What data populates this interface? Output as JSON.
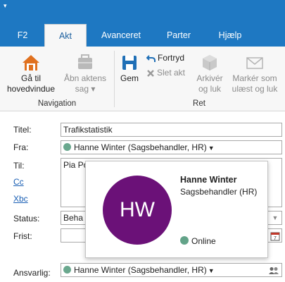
{
  "quick_access": {
    "icon": "caret-down-icon",
    "glyph": "▾"
  },
  "tabs": [
    {
      "label": "F2",
      "active": false
    },
    {
      "label": "Akt",
      "active": true
    },
    {
      "label": "Avanceret",
      "active": false
    },
    {
      "label": "Parter",
      "active": false
    },
    {
      "label": "Hjælp",
      "active": false
    }
  ],
  "ribbon": {
    "navigation": {
      "group_label": "Navigation",
      "home": {
        "line1": "Gå til",
        "line2": "hovedvindue"
      },
      "open_case": {
        "line1": "Åbn aktens",
        "line2": "sag ▾"
      }
    },
    "ret": {
      "group_label": "Ret",
      "save": "Gem",
      "undo": "Fortryd",
      "delete": "Slet akt",
      "archive": {
        "line1": "Arkivér",
        "line2": "og luk"
      },
      "mark_unread": {
        "line1": "Markér som",
        "line2": "ulæst og luk"
      }
    }
  },
  "form": {
    "title_label": "Titel:",
    "title_value": "Trafikstatistik",
    "from_label": "Fra:",
    "from_value": "Hanne Winter (Sagsbehandler, HR)",
    "to_label": "Til:",
    "to_value": "Pia Po...",
    "cc_label": "Cc",
    "bcc_label": "Xbc",
    "status_label": "Status:",
    "status_value": "Beha",
    "deadline_label": "Frist:",
    "responsible_label": "Ansvarlig:",
    "responsible_value": "Hanne Winter (Sagsbehandler, HR)"
  },
  "contact_card": {
    "initials": "HW",
    "name": "Hanne Winter",
    "role": "Sagsbehandler (HR)",
    "presence": "Online"
  },
  "colors": {
    "accent": "#1e78c2",
    "avatar": "#6b1178",
    "presence_online": "#63a389"
  }
}
